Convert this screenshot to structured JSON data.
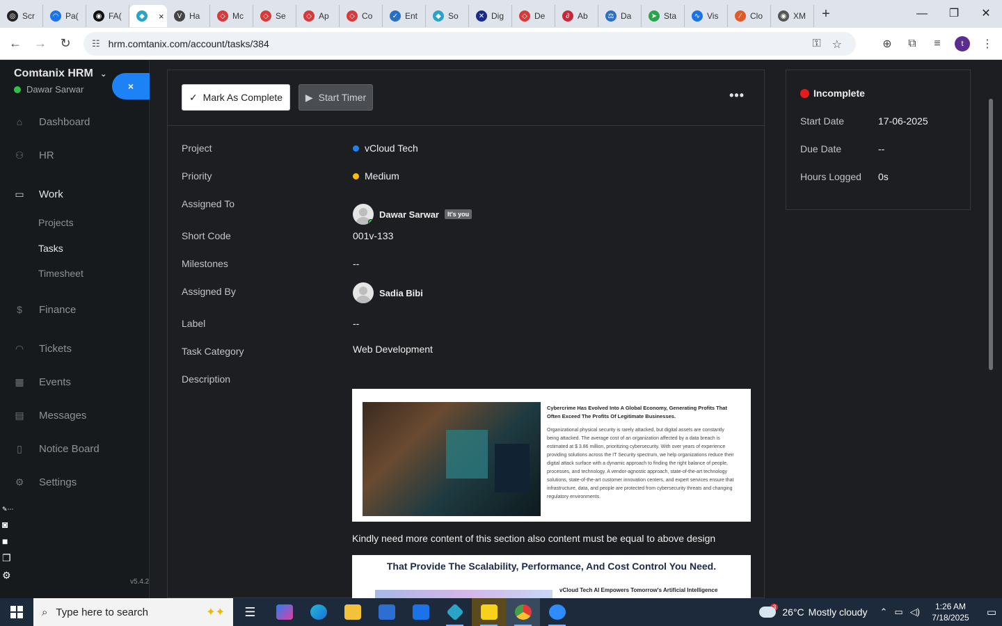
{
  "browser": {
    "tabs": [
      {
        "label": "Scr",
        "fav_color": "#222222",
        "fav": "◎"
      },
      {
        "label": "Pa(",
        "fav_color": "#1a73e8",
        "fav": "◠"
      },
      {
        "label": "FA(",
        "fav_color": "#111111",
        "fav": "◉"
      },
      {
        "label": "",
        "fav_color": "#2aa4c4",
        "fav": "◆",
        "active": true
      },
      {
        "label": "Ha",
        "fav_color": "#444444",
        "fav": "V"
      },
      {
        "label": "Mc",
        "fav_color": "#d63a3a",
        "fav": "◇"
      },
      {
        "label": "Se",
        "fav_color": "#d63a3a",
        "fav": "◇"
      },
      {
        "label": "Ap",
        "fav_color": "#d63a3a",
        "fav": "◇"
      },
      {
        "label": "Co",
        "fav_color": "#d63a3a",
        "fav": "◇"
      },
      {
        "label": "Ent",
        "fav_color": "#2a6fc4",
        "fav": "✓"
      },
      {
        "label": "So",
        "fav_color": "#2aa4c4",
        "fav": "◆"
      },
      {
        "label": "Dig",
        "fav_color": "#1a2a8a",
        "fav": "✕"
      },
      {
        "label": "De",
        "fav_color": "#d63a3a",
        "fav": "◇"
      },
      {
        "label": "Ab",
        "fav_color": "#c4283a",
        "fav": "∂"
      },
      {
        "label": "Da",
        "fav_color": "#2a6fc4",
        "fav": "⚖"
      },
      {
        "label": "Sta",
        "fav_color": "#2aa44a",
        "fav": "➤"
      },
      {
        "label": "Vis",
        "fav_color": "#1a73e8",
        "fav": "∿"
      },
      {
        "label": "Clo",
        "fav_color": "#e05a2a",
        "fav": "⁄"
      },
      {
        "label": "XM",
        "fav_color": "#555555",
        "fav": "◉"
      }
    ],
    "active_tab_close": "×",
    "new_tab": "+",
    "url": "hrm.comtanix.com/account/tasks/384",
    "profile_initial": "t"
  },
  "sidebar": {
    "brand": "Comtanix HRM",
    "user": "Dawar Sarwar",
    "close_label": "×",
    "items": [
      {
        "label": "Dashboard",
        "icon": "⌂",
        "name": "dashboard"
      },
      {
        "label": "HR",
        "icon": "⚇",
        "name": "hr"
      },
      {
        "label": "Work",
        "icon": "▭",
        "name": "work",
        "active": true
      },
      {
        "label": "Finance",
        "icon": "$",
        "name": "finance"
      },
      {
        "label": "Tickets",
        "icon": "◠",
        "name": "tickets"
      },
      {
        "label": "Events",
        "icon": "▦",
        "name": "events"
      },
      {
        "label": "Messages",
        "icon": "▤",
        "name": "messages"
      },
      {
        "label": "Notice Board",
        "icon": "▯",
        "name": "notice-board"
      },
      {
        "label": "Settings",
        "icon": "⚙",
        "name": "settings"
      }
    ],
    "work_sub": [
      {
        "label": "Projects"
      },
      {
        "label": "Tasks",
        "active": true
      },
      {
        "label": "Timesheet"
      }
    ],
    "version": "v5.4.2"
  },
  "task": {
    "mark_complete": "Mark As Complete",
    "start_timer": "Start Timer",
    "more": "•••",
    "fields": {
      "project": {
        "label": "Project",
        "value": "vCloud Tech",
        "dot": "#1d82f5"
      },
      "priority": {
        "label": "Priority",
        "value": "Medium",
        "dot": "#fcbd01"
      },
      "assigned_to": {
        "label": "Assigned To",
        "value": "Dawar Sarwar",
        "badge": "It's you"
      },
      "short_code": {
        "label": "Short Code",
        "value": "001v-133"
      },
      "milestones": {
        "label": "Milestones",
        "value": "--"
      },
      "assigned_by": {
        "label": "Assigned By",
        "value": "Sadia Bibi"
      },
      "label": {
        "label": "Label",
        "value": "--"
      },
      "category": {
        "label": "Task Category",
        "value": "Web Development"
      },
      "description": {
        "label": "Description"
      }
    },
    "desc_image1": {
      "title": "Cybercrime Has Evolved Into A Global Economy, Generating Profits That Often Exceed The Profits Of Legitimate Businesses.",
      "body": "Organizational physical security is rarely attacked, but digital assets are constantly being attacked. The average cost of an organization affected by a data breach is estimated at $ 3.86 million, prioritizing cybersecurity. With over years of experience providing solutions across the IT Security spectrum, we help organizations reduce their digital attack surface with a dynamic approach to finding the right balance of people, processes, and technology. A vendor-agnostic approach, state-of-the-art technology solutions, state-of-the-art customer innovation centers, and expert services ensure that infrastructure, data, and people are protected from cybersecurity threats and changing regulatory environments."
    },
    "desc_text": "Kindly need more content of this section also content must be equal to above design",
    "desc_image2": {
      "heading": "That Provide The Scalability, Performance, And Cost Control You Need.",
      "sub": "vCloud Tech AI Empowers Tomorrow's Artificial Intelligence"
    }
  },
  "status_card": {
    "status": "Incomplete",
    "status_color": "#e11d1d",
    "start_date_label": "Start Date",
    "start_date": "17-06-2025",
    "due_date_label": "Due Date",
    "due_date": "--",
    "hours_label": "Hours Logged",
    "hours": "0s"
  },
  "taskbar": {
    "search_placeholder": "Type here to search",
    "weather_temp": "26°C",
    "weather_text": "Mostly cloudy",
    "weather_badge": "3",
    "time": "1:26 AM",
    "date": "7/18/2025"
  }
}
